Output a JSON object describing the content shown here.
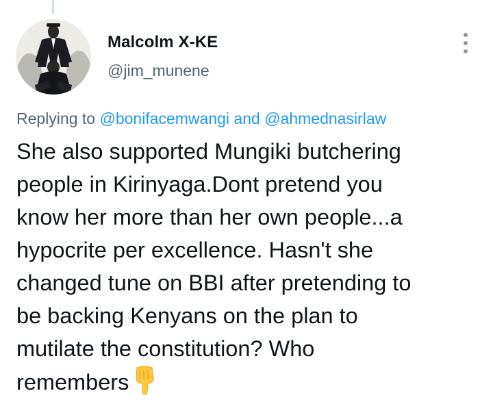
{
  "tweet": {
    "author": {
      "display_name": "Malcolm X-KE",
      "handle": "@jim_munene"
    },
    "reply": {
      "prefix": "Replying to",
      "mention_1": "@bonifacemwangi",
      "joiner": "and",
      "mention_2": "@ahmednasirlaw"
    },
    "text_lines": [
      "She also supported Mungiki butchering",
      "people in Kirinyaga.Dont pretend you",
      "know her more than her own people...a",
      "hypocrite per excellence. Hasn't she",
      "changed tune on BBI after pretending to",
      "be backing Kenyans on the plan to",
      "mutilate the constitution? Who",
      "remembers"
    ],
    "emoji": "backhand-index-pointing-down"
  },
  "icons": {
    "more": "more-options-icon"
  },
  "colors": {
    "text": "#0f1419",
    "secondary": "#536471",
    "link": "#1d9bf0"
  }
}
